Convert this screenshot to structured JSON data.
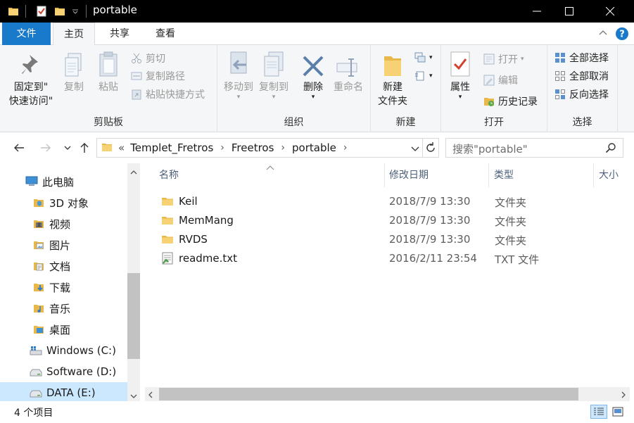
{
  "window": {
    "title": "portable"
  },
  "ribbon_tabs": [
    {
      "label": "文件"
    },
    {
      "label": "主页"
    },
    {
      "label": "共享"
    },
    {
      "label": "查看"
    }
  ],
  "ribbon": {
    "clipboard": {
      "label": "剪贴板",
      "pin_line1": "固定到\"",
      "pin_line2": "快速访问\"",
      "copy": "复制",
      "paste": "粘贴",
      "cut": "剪切",
      "copy_path": "复制路径",
      "paste_shortcut": "粘贴快捷方式"
    },
    "organize": {
      "label": "组织",
      "move_to": "移动到",
      "copy_to": "复制到",
      "delete": "删除",
      "rename": "重命名"
    },
    "new": {
      "label": "新建",
      "new_folder_line1": "新建",
      "new_folder_line2": "文件夹"
    },
    "open": {
      "label": "打开",
      "properties": "属性",
      "open": "打开",
      "edit": "编辑",
      "history": "历史记录"
    },
    "select": {
      "label": "选择",
      "select_all": "全部选择",
      "select_none": "全部取消",
      "invert": "反向选择"
    }
  },
  "address": {
    "prefix": "«",
    "crumbs": [
      "Templet_Fretros",
      "Freetros",
      "portable"
    ]
  },
  "search": {
    "placeholder": "搜索\"portable\""
  },
  "nav_pane": [
    {
      "label": "此电脑",
      "icon": "computer-icon"
    },
    {
      "label": "3D 对象",
      "icon": "3d-objects-icon"
    },
    {
      "label": "视频",
      "icon": "video-folder-icon"
    },
    {
      "label": "图片",
      "icon": "pictures-folder-icon"
    },
    {
      "label": "文档",
      "icon": "documents-folder-icon"
    },
    {
      "label": "下载",
      "icon": "downloads-folder-icon"
    },
    {
      "label": "音乐",
      "icon": "music-folder-icon"
    },
    {
      "label": "桌面",
      "icon": "desktop-folder-icon"
    },
    {
      "label": "Windows (C:)",
      "icon": "windows-drive-icon"
    },
    {
      "label": "Software (D:)",
      "icon": "drive-icon"
    },
    {
      "label": "DATA (E:)",
      "icon": "drive-icon"
    }
  ],
  "columns": {
    "name": "名称",
    "date": "修改日期",
    "type": "类型",
    "size": "大小"
  },
  "files": [
    {
      "name": "Keil",
      "date": "2018/7/9 13:30",
      "type": "文件夹",
      "icon": "folder-icon"
    },
    {
      "name": "MemMang",
      "date": "2018/7/9 13:30",
      "type": "文件夹",
      "icon": "folder-icon"
    },
    {
      "name": "RVDS",
      "date": "2018/7/9 13:30",
      "type": "文件夹",
      "icon": "folder-icon"
    },
    {
      "name": "readme.txt",
      "date": "2016/2/11 23:54",
      "type": "TXT 文件",
      "icon": "text-file-icon"
    }
  ],
  "status": {
    "count": "4 个项目"
  },
  "colors": {
    "file_tab": "#1979ca",
    "selection": "#cce8ff",
    "folder": "#e8b84a",
    "help": "#1979ca"
  }
}
